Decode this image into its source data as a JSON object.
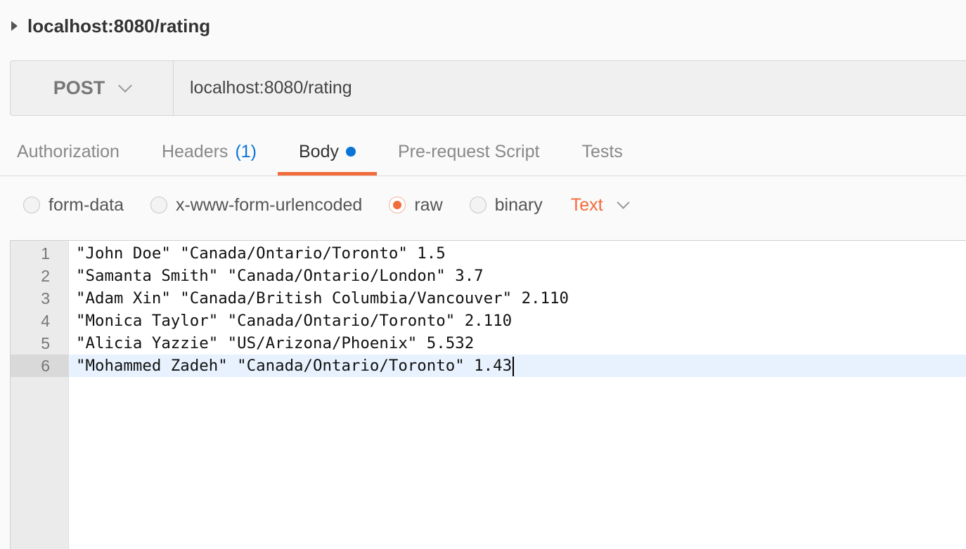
{
  "request": {
    "name": "localhost:8080/rating"
  },
  "url_bar": {
    "method": "POST",
    "url": "localhost:8080/rating"
  },
  "tabs": [
    {
      "label": "Authorization"
    },
    {
      "label": "Headers",
      "count": "(1)"
    },
    {
      "label": "Body",
      "active": true
    },
    {
      "label": "Pre-request Script"
    },
    {
      "label": "Tests"
    }
  ],
  "body_types": {
    "options": [
      "form-data",
      "x-www-form-urlencoded",
      "raw",
      "binary"
    ],
    "selected": "raw",
    "format": "Text"
  },
  "editor": {
    "line_numbers": [
      "1",
      "2",
      "3",
      "4",
      "5",
      "6"
    ],
    "lines": [
      "\"John Doe\" \"Canada/Ontario/Toronto\" 1.5",
      "\"Samanta Smith\" \"Canada/Ontario/London\" 3.7",
      "\"Adam Xin\" \"Canada/British Columbia/Vancouver\" 2.110",
      "\"Monica Taylor\" \"Canada/Ontario/Toronto\" 2.110",
      "\"Alicia Yazzie\" \"US/Arizona/Phoenix\" 5.532",
      "\"Mohammed Zadeh\" \"Canada/Ontario/Toronto\" 1.43"
    ],
    "active_line": 6
  },
  "colors": {
    "accent": "#f26b3a",
    "link": "#0a74d9"
  }
}
